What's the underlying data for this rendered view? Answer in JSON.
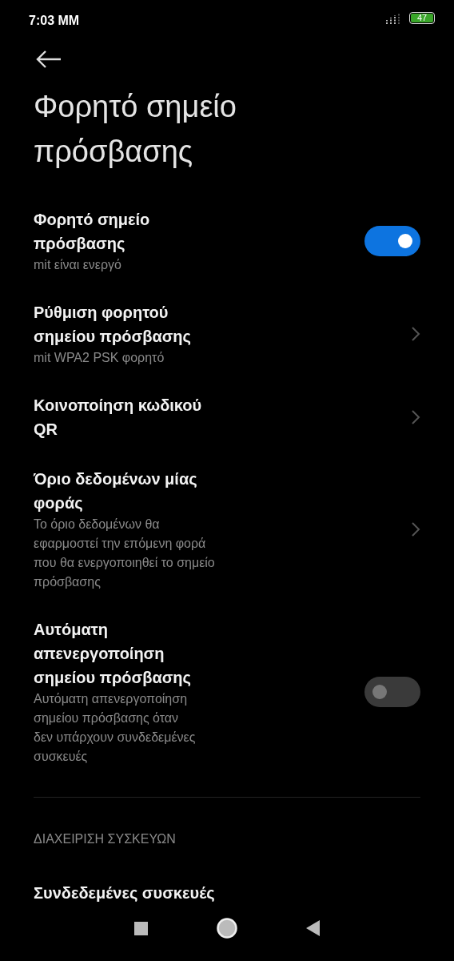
{
  "status_bar": {
    "time": "7:03 MM",
    "battery": "47"
  },
  "title": "Φορητό σημείο πρόσβασης",
  "items": [
    {
      "kind": "toggle",
      "title": "Φορητό σημείο πρόσβασης",
      "subtitle": "mit είναι ενεργό",
      "on": true
    },
    {
      "kind": "link",
      "title": "Ρύθμιση φορητού σημείου πρόσβασης",
      "subtitle": "mit WPA2 PSK φορητό"
    },
    {
      "kind": "link",
      "title": "Κοινοποίηση κωδικού QR"
    },
    {
      "kind": "link",
      "title": "Όριο δεδομένων μίας φοράς",
      "subtitle": "Το όριο δεδομένων θα εφαρμοστεί την επόμενη φορά που θα ενεργοποιηθεί το σημείο πρόσβασης"
    },
    {
      "kind": "toggle",
      "title": "Αυτόματη απενεργοποίηση σημείου πρόσβασης",
      "subtitle": "Αυτόματη απενεργοποίηση σημείου πρόσβασης όταν δεν υπάρχουν συνδεδεμένες συσκευές",
      "on": false
    },
    {
      "kind": "divider"
    },
    {
      "kind": "header",
      "title": "ΔΙΑΧΕΙΡΙΣΗ ΣΥΣΚΕΥΩΝ"
    },
    {
      "kind": "plain",
      "title": "Συνδεδεμένες συσκευές"
    }
  ]
}
